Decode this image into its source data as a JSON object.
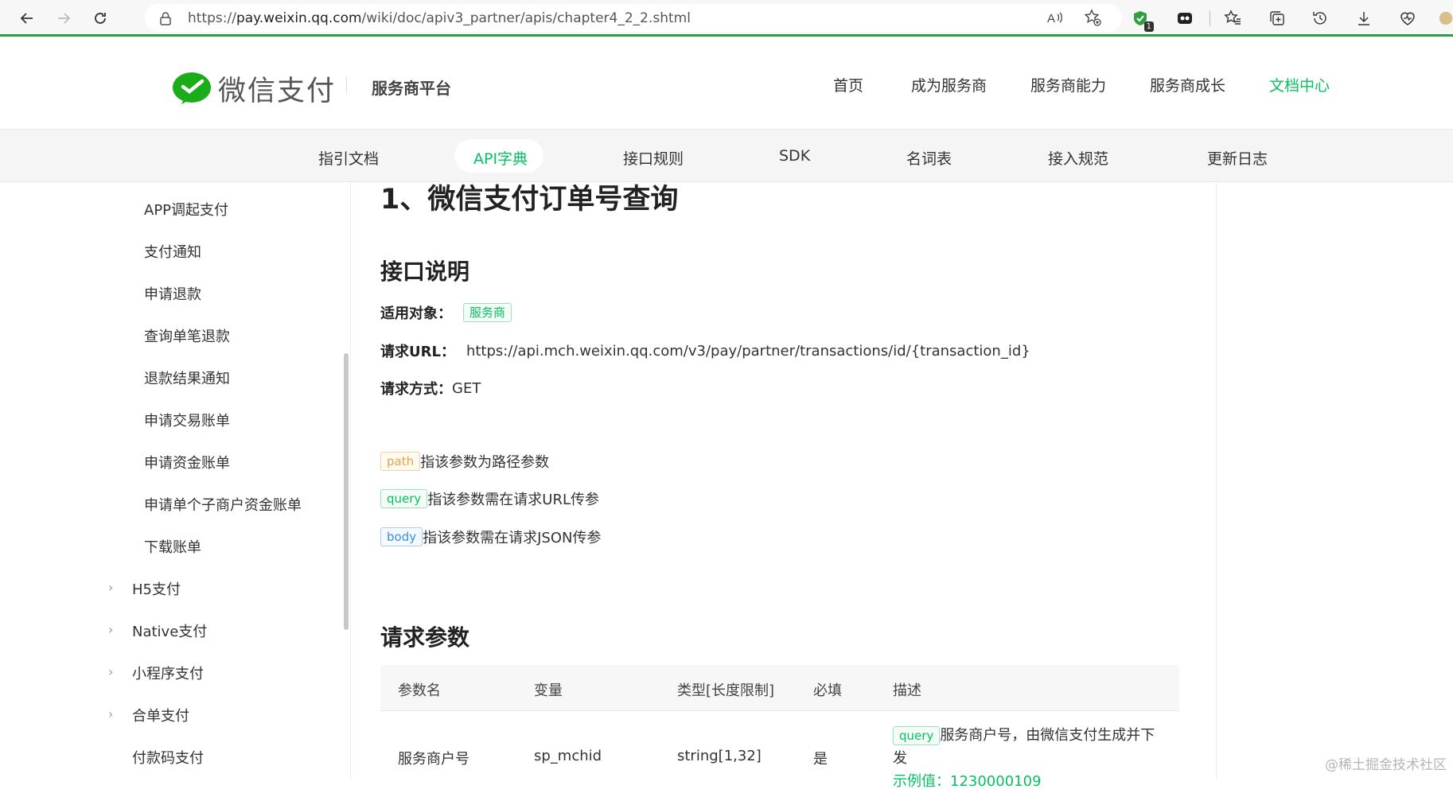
{
  "browser": {
    "url_prefix": "https://",
    "url_host": "pay.weixin.qq.com",
    "url_path": "/wiki/doc/apiv3_partner/apis/chapter4_2_2.shtml",
    "extension_badge": "1"
  },
  "header": {
    "logo_text": "微信支付",
    "platform": "服务商平台",
    "nav": [
      {
        "label": "首页"
      },
      {
        "label": "成为服务商"
      },
      {
        "label": "服务商能力"
      },
      {
        "label": "服务商成长"
      },
      {
        "label": "文档中心",
        "active": true
      }
    ]
  },
  "subnav": [
    {
      "label": "指引文档"
    },
    {
      "label": "API字典",
      "active": true
    },
    {
      "label": "接口规则"
    },
    {
      "label": "SDK"
    },
    {
      "label": "名词表"
    },
    {
      "label": "接入规范"
    },
    {
      "label": "更新日志"
    }
  ],
  "sidebar": {
    "sub_items": [
      "APP调起支付",
      "支付通知",
      "申请退款",
      "查询单笔退款",
      "退款结果通知",
      "申请交易账单",
      "申请资金账单",
      "申请单个子商户资金账单",
      "下载账单"
    ],
    "groups": [
      "H5支付",
      "Native支付",
      "小程序支付",
      "合单支付",
      "付款码支付"
    ]
  },
  "main": {
    "title": "1、微信支付订单号查询",
    "section_desc": "接口说明",
    "target_label": "适用对象：",
    "target_tag": "服务商",
    "url_label": "请求URL：",
    "url_value": "https://api.mch.weixin.qq.com/v3/pay/partner/transactions/id/{transaction_id}",
    "method_label": "请求方式：",
    "method_value": "GET",
    "legend": [
      {
        "tag": "path",
        "text": "指该参数为路径参数",
        "color": "orange"
      },
      {
        "tag": "query",
        "text": "指该参数需在请求URL传参",
        "color": "green"
      },
      {
        "tag": "body",
        "text": "指该参数需在请求JSON传参",
        "color": "blue"
      }
    ],
    "section_params": "请求参数",
    "table": {
      "headers": [
        "参数名",
        "变量",
        "类型[长度限制]",
        "必填",
        "描述"
      ],
      "rows": [
        {
          "name": "服务商户号",
          "var": "sp_mchid",
          "type": "string[1,32]",
          "required": "是",
          "desc_tag": "query",
          "desc_text": "服务商户号，由微信支付生成并下发",
          "desc_example": "示例值：1230000109"
        }
      ]
    }
  },
  "watermark": "@稀土掘金技术社区",
  "colors": {
    "accent": "#07c160",
    "brand_green": "#2ea043"
  }
}
